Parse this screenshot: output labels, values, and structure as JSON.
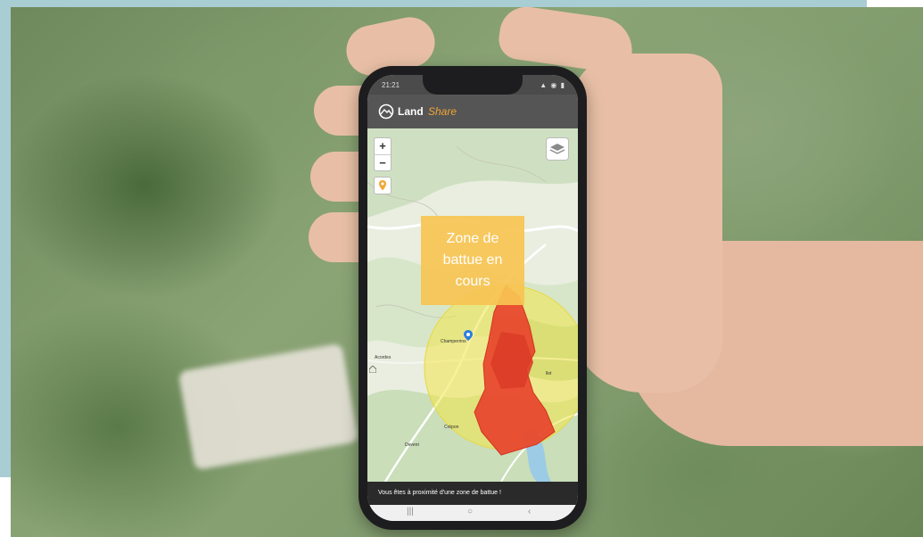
{
  "status_bar": {
    "time": "21:21",
    "icons": "▲ ◉ ▮"
  },
  "app": {
    "logo_part1": "Land",
    "logo_part2": "Share"
  },
  "map": {
    "zoom_in": "+",
    "zoom_out": "−",
    "overlay_text": "Zone de battue en cours",
    "places": {
      "champerrins": "Champerrins",
      "acordes": "Acordes",
      "crepon": "Crépon",
      "devent": "Devent",
      "lieu": "llet"
    }
  },
  "alert": {
    "message": "Vous êtes à proximité d'une zone de battue !"
  },
  "android_nav": {
    "recents": "|||",
    "home": "○",
    "back": "‹"
  },
  "colors": {
    "accent_orange": "#f0a535",
    "hunt_zone_red": "#e8402a",
    "proximity_yellow": "#f3e64a",
    "overlay_yellow": "#f7c452",
    "header_grey": "#555555",
    "frame_teal": "#a8cdd3"
  },
  "icons": [
    "logo-icon",
    "locate-icon",
    "layers-icon",
    "user-location-icon",
    "house-icon"
  ]
}
